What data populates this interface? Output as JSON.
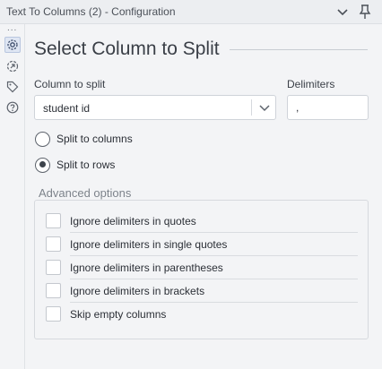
{
  "window": {
    "title": "Text To Columns (2) - Configuration",
    "collapse_icon": "chevron-down-icon",
    "pin_icon": "pin-icon"
  },
  "sidebar": {
    "more": "...",
    "icons": [
      "gear-icon",
      "connection-icon",
      "tag-icon",
      "help-icon"
    ]
  },
  "section": {
    "heading": "Select Column to Split"
  },
  "column_to_split": {
    "label": "Column to split",
    "value": "student id"
  },
  "delimiters": {
    "label": "Delimiters",
    "value": ","
  },
  "split_options": [
    {
      "label": "Split to columns",
      "selected": false
    },
    {
      "label": "Split to rows",
      "selected": true
    }
  ],
  "advanced": {
    "label": "Advanced options",
    "options": [
      {
        "label": "Ignore delimiters in quotes",
        "checked": false
      },
      {
        "label": "Ignore delimiters in single quotes",
        "checked": false
      },
      {
        "label": "Ignore delimiters in parentheses",
        "checked": false
      },
      {
        "label": "Ignore delimiters in brackets",
        "checked": false
      },
      {
        "label": "Skip empty columns",
        "checked": false
      }
    ]
  }
}
